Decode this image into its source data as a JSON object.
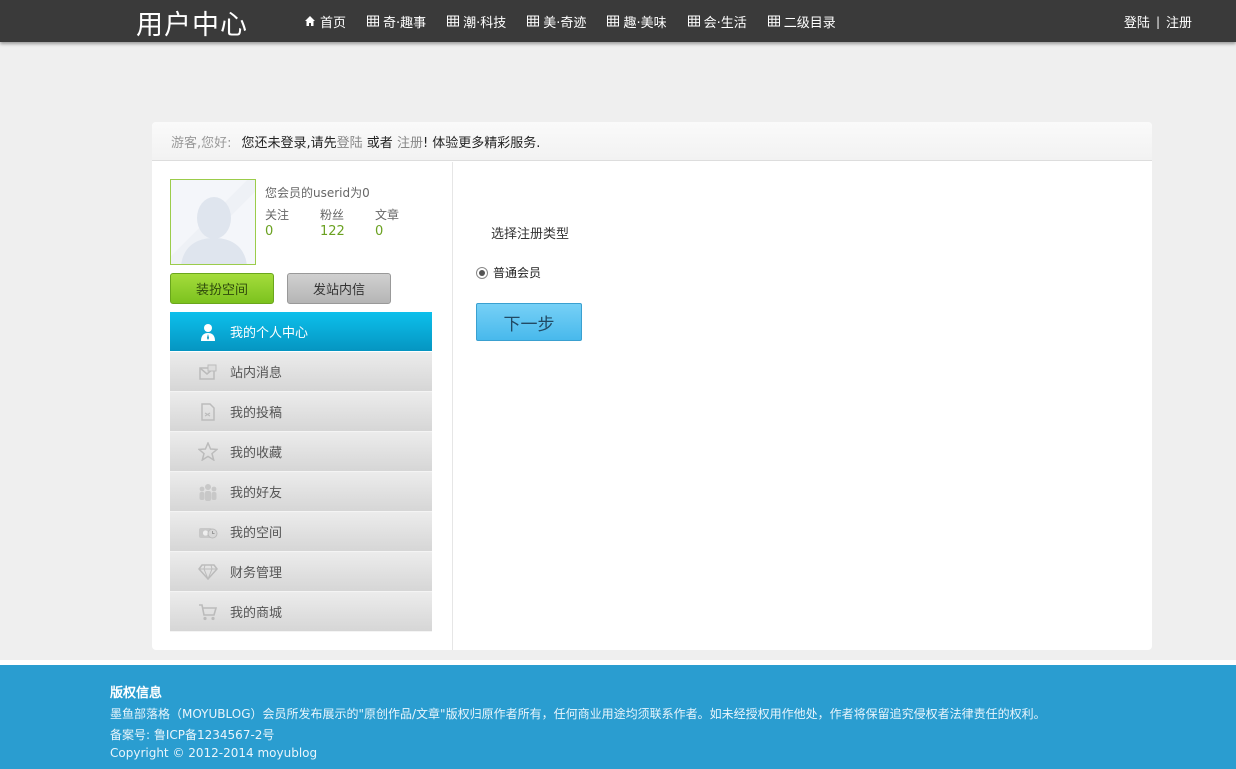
{
  "header": {
    "logo": "用户中心",
    "nav": [
      {
        "label": "首页",
        "icon": "home-icon"
      },
      {
        "label": "奇·趣事",
        "icon": "grid-icon"
      },
      {
        "label": "潮·科技",
        "icon": "grid-icon"
      },
      {
        "label": "美·奇迹",
        "icon": "grid-icon"
      },
      {
        "label": "趣·美味",
        "icon": "grid-icon"
      },
      {
        "label": "会·生活",
        "icon": "grid-icon"
      },
      {
        "label": "二级目录",
        "icon": "grid-icon"
      }
    ],
    "login": "登陆",
    "separator": "|",
    "register": "注册"
  },
  "notice": {
    "guest": "游客,您好:",
    "text_before": "您还未登录,请先",
    "login_link": "登陆",
    "text_middle": " 或者 ",
    "register_link": "注册",
    "text_after": "! 体验更多精彩服务."
  },
  "profile": {
    "uid_text": "您会员的userid为0",
    "stats": [
      {
        "label": "关注",
        "value": "0"
      },
      {
        "label": "粉丝",
        "value": "122"
      },
      {
        "label": "文章",
        "value": "0"
      }
    ],
    "decorate_button": "装扮空间",
    "message_button": "发站内信"
  },
  "menu": [
    {
      "label": "我的个人中心",
      "icon": "user-icon",
      "active": true
    },
    {
      "label": "站内消息",
      "icon": "message-icon",
      "active": false
    },
    {
      "label": "我的投稿",
      "icon": "document-icon",
      "active": false
    },
    {
      "label": "我的收藏",
      "icon": "star-icon",
      "active": false
    },
    {
      "label": "我的好友",
      "icon": "friends-icon",
      "active": false
    },
    {
      "label": "我的空间",
      "icon": "space-icon",
      "active": false
    },
    {
      "label": "财务管理",
      "icon": "diamond-icon",
      "active": false
    },
    {
      "label": "我的商城",
      "icon": "cart-icon",
      "active": false
    }
  ],
  "register": {
    "title": "选择注册类型",
    "option": "普通会员",
    "next_button": "下一步"
  },
  "footer": {
    "title": "版权信息",
    "line1": "墨鱼部落格（MOYUBLOG）会员所发布展示的\"原创作品/文章\"版权归原作者所有，任何商业用途均须联系作者。如未经授权用作他处，作者将保留追究侵权者法律责任的权利。",
    "line2": "备案号: 鲁ICP备1234567-2号",
    "line3": "Copyright © 2012-2014 moyublog"
  },
  "colors": {
    "topbar": "#3a3a3a",
    "accent_blue": "#0595c1",
    "accent_green": "#7cc21e",
    "footer": "#2a9dd0"
  }
}
